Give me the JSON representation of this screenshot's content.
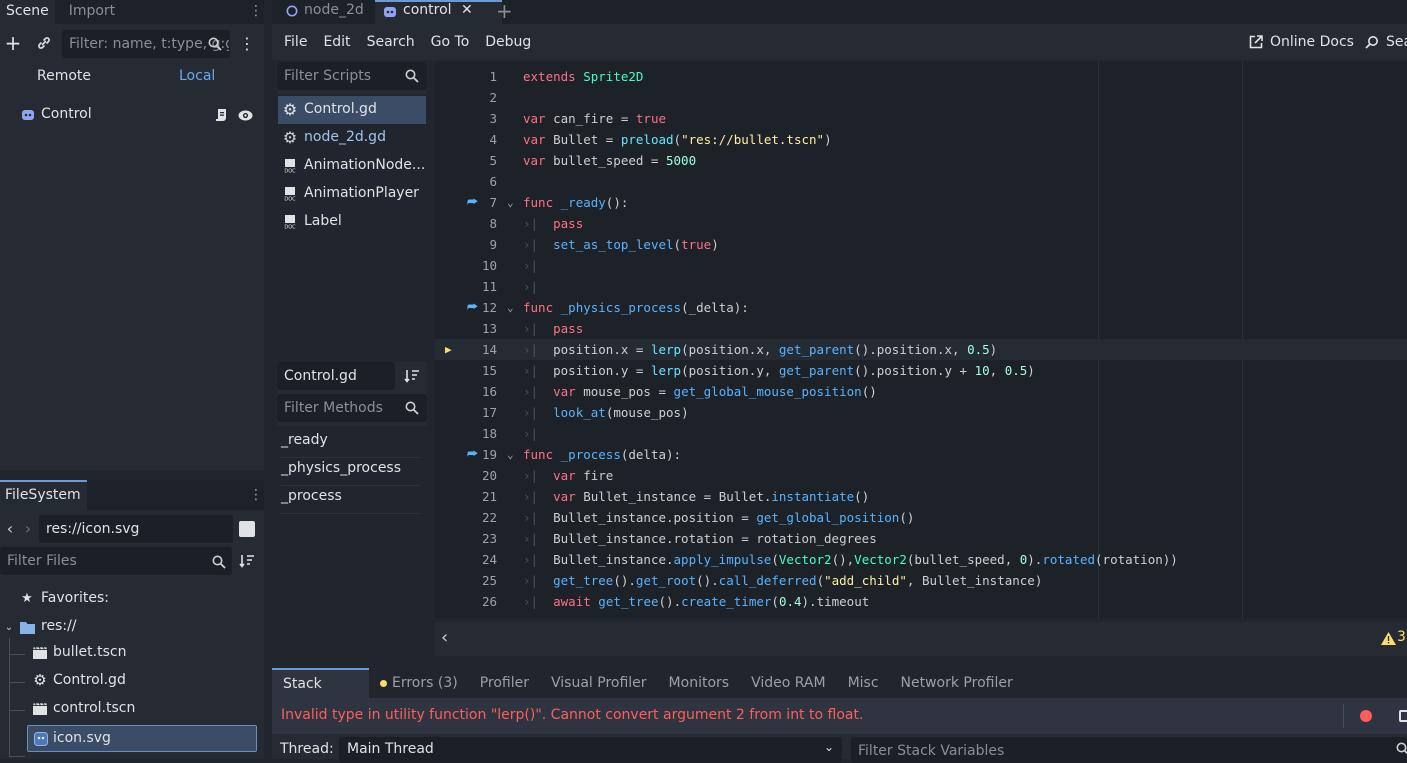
{
  "scene_panel": {
    "tabs": [
      "Scene",
      "Import"
    ],
    "filter_placeholder": "Filter: name, t:type, g:group",
    "remote_label": "Remote",
    "local_label": "Local",
    "root_node": "Control"
  },
  "filesystem": {
    "tab": "FileSystem",
    "path": "res://icon.svg",
    "filter_placeholder": "Filter Files",
    "favorites_label": "Favorites:",
    "root_label": "res://",
    "files": [
      "bullet.tscn",
      "Control.gd",
      "control.tscn",
      "icon.svg"
    ]
  },
  "editor_tabs": {
    "items": [
      "node_2d",
      "control"
    ],
    "close": "✕",
    "add": "+"
  },
  "menu": {
    "items": [
      "File",
      "Edit",
      "Search",
      "Go To",
      "Debug"
    ],
    "online_docs": "Online Docs",
    "search_help": "Sea"
  },
  "scripts_panel": {
    "filter_placeholder": "Filter Scripts",
    "items": [
      "Control.gd",
      "node_2d.gd",
      "AnimationNode...",
      "AnimationPlayer",
      "Label"
    ],
    "current_script": "Control.gd",
    "methods_placeholder": "Filter Methods",
    "methods": [
      "_ready",
      "_physics_process",
      "_process"
    ]
  },
  "code": {
    "line_numbers": [
      "1",
      "2",
      "3",
      "4",
      "5",
      "6",
      "7",
      "8",
      "9",
      "10",
      "11",
      "12",
      "13",
      "14",
      "15",
      "16",
      "17",
      "18",
      "19",
      "20",
      "21",
      "22",
      "23",
      "24",
      "25",
      "26"
    ],
    "warning_count": "3"
  },
  "bottom_panel": {
    "tabs": [
      "Stack Trace",
      "Errors (3)",
      "Profiler",
      "Visual Profiler",
      "Monitors",
      "Video RAM",
      "Misc",
      "Network Profiler"
    ],
    "error_message": "Invalid type in utility function \"lerp()\". Cannot convert argument 2 from int to float.",
    "thread_label": "Thread:",
    "thread_value": "Main Thread",
    "filter_stack_placeholder": "Filter Stack Variables"
  },
  "colors": {
    "accent": "#6a9bd8",
    "error_text": "#ff5d5d",
    "warning": "#ffdd65",
    "selection": "#3b4d66"
  }
}
